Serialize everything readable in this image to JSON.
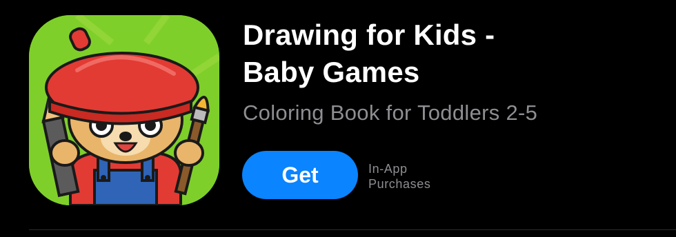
{
  "app": {
    "title_line1": "Drawing for Kids -",
    "title_line2": "Baby Games",
    "subtitle": "Coloring Book for Toddlers 2-5",
    "get_label": "Get",
    "iap_line1": "In-App",
    "iap_line2": "Purchases",
    "icon": "app-icon-bear-artist"
  },
  "colors": {
    "background": "#000000",
    "title": "#ffffff",
    "secondary_text": "#8e8e93",
    "get_button": "#0a84ff",
    "icon_background": "#7fcf2a"
  }
}
